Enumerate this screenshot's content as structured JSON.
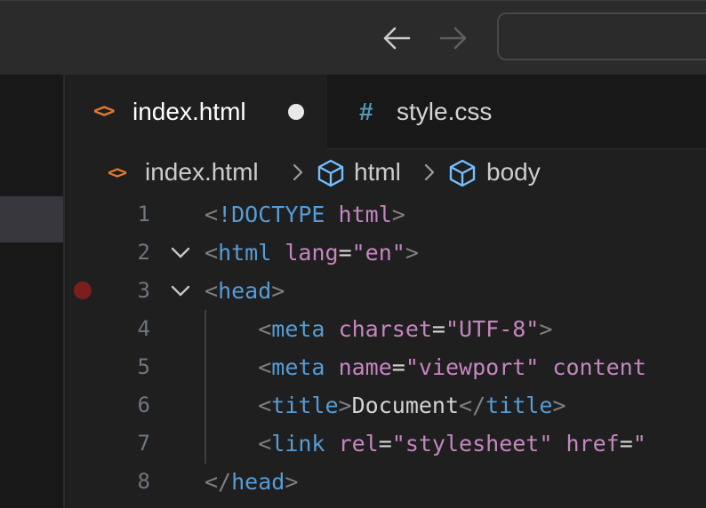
{
  "titlebar": {
    "back_icon": "arrow-left-icon",
    "forward_icon": "arrow-right-icon",
    "command_center_text": ""
  },
  "tabs": [
    {
      "label": "index.html",
      "icon": "html-file-icon",
      "active": true,
      "dirty": true
    },
    {
      "label": "style.css",
      "icon": "css-file-icon",
      "active": false,
      "dirty": false
    }
  ],
  "tab_icons": {
    "html_glyph": "<>",
    "css_glyph": "#"
  },
  "breadcrumbs": [
    {
      "label": "index.html",
      "icon": "html-file-icon"
    },
    {
      "label": "html",
      "icon": "symbol-element-icon"
    },
    {
      "label": "body",
      "icon": "symbol-element-icon"
    }
  ],
  "editor": {
    "lines": [
      {
        "number": "1",
        "fold": false,
        "breakpoint": false
      },
      {
        "number": "2",
        "fold": true,
        "breakpoint": false
      },
      {
        "number": "3",
        "fold": true,
        "breakpoint": true
      },
      {
        "number": "4",
        "fold": false,
        "breakpoint": false
      },
      {
        "number": "5",
        "fold": false,
        "breakpoint": false
      },
      {
        "number": "6",
        "fold": false,
        "breakpoint": false
      },
      {
        "number": "7",
        "fold": false,
        "breakpoint": false
      },
      {
        "number": "8",
        "fold": false,
        "breakpoint": false
      }
    ],
    "tokens": {
      "l1": {
        "lt": "<",
        "bang": "!",
        "doctype": "DOCTYPE",
        "sp": " ",
        "html": "html",
        "gt": ">"
      },
      "l2": {
        "lt": "<",
        "tag": "html",
        "sp": " ",
        "attr": "lang",
        "eq": "=",
        "val": "\"en\"",
        "gt": ">"
      },
      "l3": {
        "lt": "<",
        "tag": "head",
        "gt": ">"
      },
      "l4": {
        "indent": "    ",
        "lt": "<",
        "tag": "meta",
        "sp": " ",
        "attr": "charset",
        "eq": "=",
        "val": "\"UTF-8\"",
        "gt": ">"
      },
      "l5": {
        "indent": "    ",
        "lt": "<",
        "tag": "meta",
        "sp": " ",
        "attr": "name",
        "eq": "=",
        "val": "\"viewport\"",
        "sp2": " ",
        "attr2": "content"
      },
      "l6": {
        "indent": "    ",
        "lt": "<",
        "tag": "title",
        "gt": ">",
        "text": "Document",
        "lt2": "</",
        "tag2": "title",
        "gt2": ">"
      },
      "l7": {
        "indent": "    ",
        "lt": "<",
        "tag": "link",
        "sp": " ",
        "attr": "rel",
        "eq": "=",
        "val": "\"stylesheet\"",
        "sp2": " ",
        "attr2": "href",
        "eq2": "=",
        "val2": "\""
      },
      "l8": {
        "lt": "</",
        "tag": "head",
        "gt": ">"
      }
    }
  },
  "colors": {
    "background": "#1f1f1f",
    "titlebar": "#2b2b2b",
    "sidebar": "#181818",
    "html_icon": "#e37933",
    "css_icon": "#519aba",
    "breakpoint": "#7a1e1e",
    "tag": "#569cd6",
    "attribute": "#9cdcfe",
    "string": "#ce9178",
    "punctuation": "#808080"
  }
}
